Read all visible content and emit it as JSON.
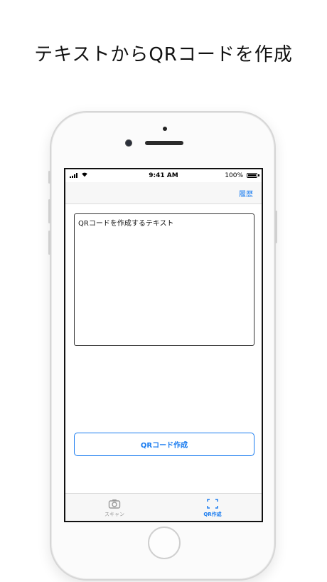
{
  "headline": "テキストからQRコードを作成",
  "status_bar": {
    "time": "9:41 AM",
    "battery": "100%"
  },
  "nav": {
    "history_label": "履歴"
  },
  "editor": {
    "text": "QRコードを作成するテキスト"
  },
  "actions": {
    "create_label": "QRコード作成"
  },
  "tabs": [
    {
      "label": "スキャン",
      "icon": "camera-icon",
      "selected": false
    },
    {
      "label": "QR作成",
      "icon": "qr-frame-icon",
      "selected": true
    }
  ],
  "colors": {
    "accent": "#1a7cf0",
    "inactive": "#9a9a9a"
  }
}
